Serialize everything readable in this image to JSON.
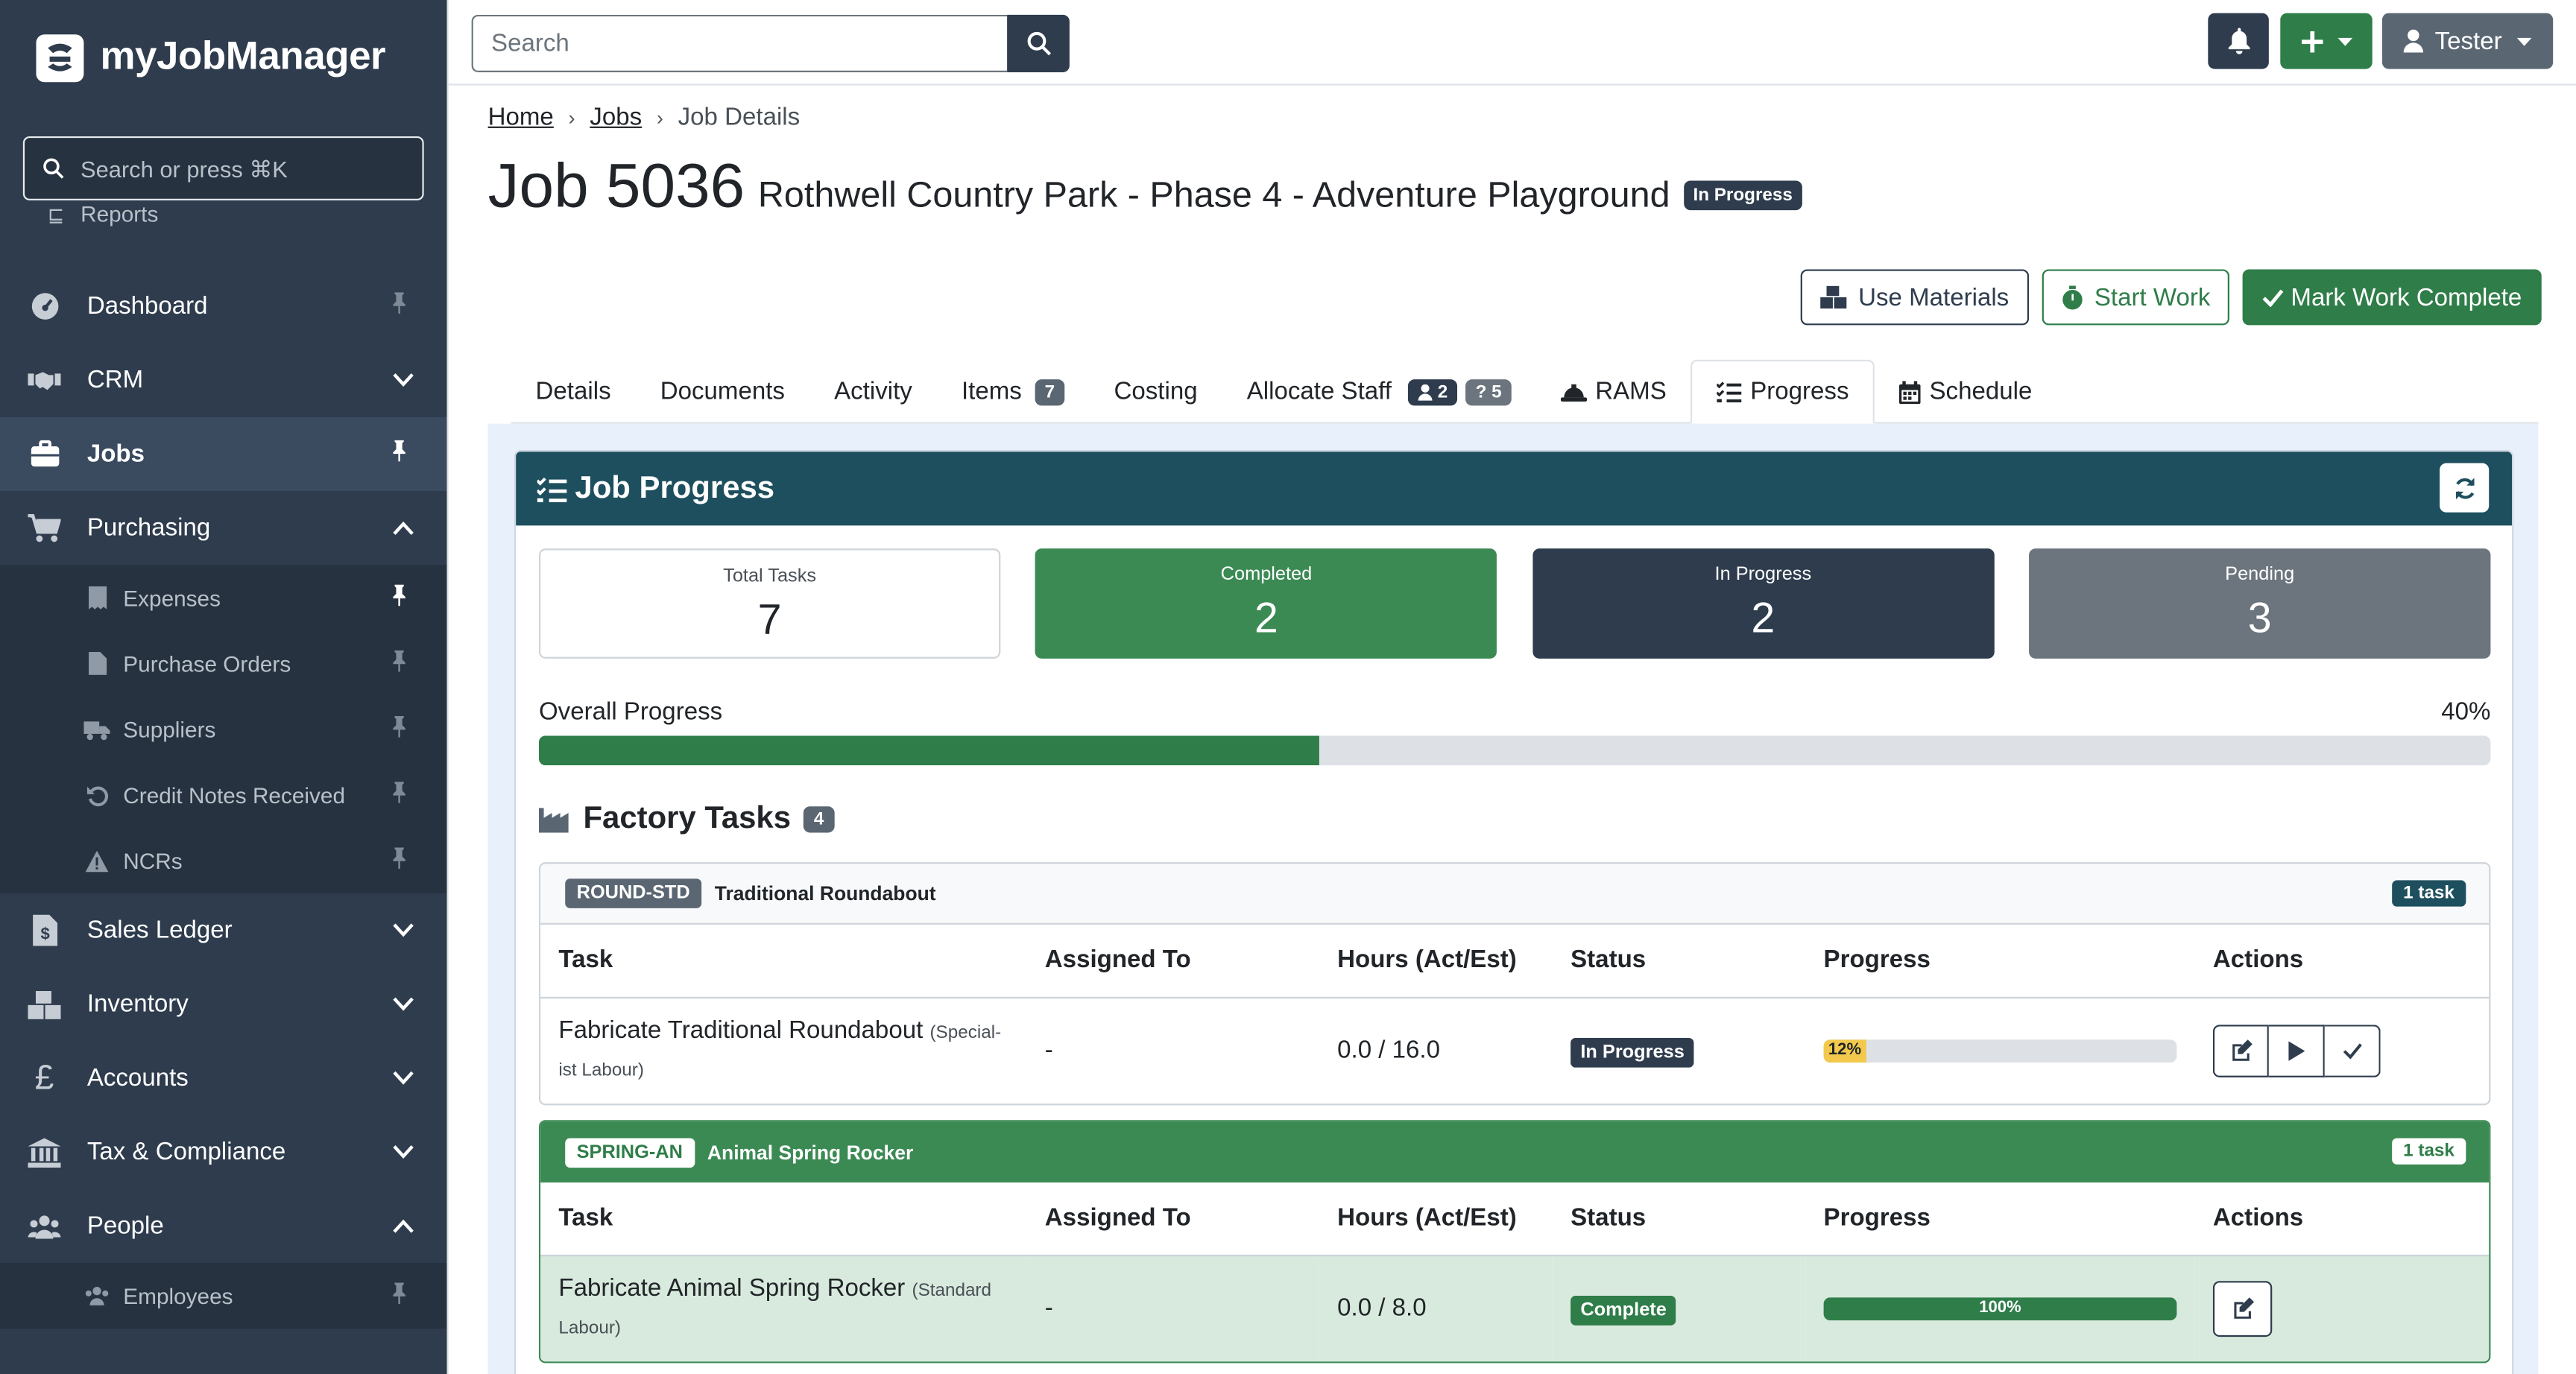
{
  "app": {
    "brand": "myJobManager"
  },
  "sidebar": {
    "search_placeholder": "Search or press ⌘K",
    "reports_label": "Reports",
    "items": [
      {
        "label": "Dashboard",
        "icon": "gauge-icon"
      },
      {
        "label": "CRM",
        "icon": "handshake-icon"
      },
      {
        "label": "Jobs",
        "icon": "briefcase-icon"
      },
      {
        "label": "Purchasing",
        "icon": "cart-icon"
      },
      {
        "label": "Sales Ledger",
        "icon": "invoice-dollar-icon"
      },
      {
        "label": "Inventory",
        "icon": "boxes-icon"
      },
      {
        "label": "Accounts",
        "icon": "pound-icon"
      },
      {
        "label": "Tax & Compliance",
        "icon": "bank-icon"
      },
      {
        "label": "People",
        "icon": "users-icon"
      }
    ],
    "purchasing_sub": [
      {
        "label": "Expenses"
      },
      {
        "label": "Purchase Orders"
      },
      {
        "label": "Suppliers"
      },
      {
        "label": "Credit Notes Received"
      },
      {
        "label": "NCRs"
      }
    ],
    "people_sub": [
      {
        "label": "Employees"
      }
    ]
  },
  "topbar": {
    "search_placeholder": "Search",
    "user_label": "Tester"
  },
  "breadcrumb": [
    "Home",
    "Jobs",
    "Job Details"
  ],
  "job": {
    "number": "Job 5036",
    "name": "Rothwell Country Park - Phase 4 - Adventure Playground",
    "status": "In Progress"
  },
  "actions": {
    "use_materials": "Use Materials",
    "start_work": "Start Work",
    "mark_complete": "Mark Work Complete"
  },
  "tabs": [
    {
      "label": "Details"
    },
    {
      "label": "Documents"
    },
    {
      "label": "Activity"
    },
    {
      "label": "Items",
      "count": "7"
    },
    {
      "label": "Costing"
    },
    {
      "label": "Allocate Staff",
      "staff_count": "2",
      "unknown_count": "5"
    },
    {
      "label": "RAMS"
    },
    {
      "label": "Progress"
    },
    {
      "label": "Schedule"
    }
  ],
  "progress": {
    "title": "Job Progress",
    "stats": [
      {
        "label": "Total Tasks",
        "value": "7"
      },
      {
        "label": "Completed",
        "value": "2"
      },
      {
        "label": "In Progress",
        "value": "2"
      },
      {
        "label": "Pending",
        "value": "3"
      }
    ],
    "overall_label": "Overall Progress",
    "overall_text": "40%",
    "overall_fraction": 0.4
  },
  "factory_tasks": {
    "title": "Factory Tasks",
    "count": "4",
    "columns": [
      "Task",
      "Assigned To",
      "Hours (Act/Est)",
      "Status",
      "Progress",
      "Actions"
    ],
    "groups": [
      {
        "code": "ROUND-STD",
        "name": "Traditional Roundabout",
        "count_label": "1 task",
        "task": {
          "name": "Fabricate Traditional Roundabout",
          "type": "(Special-ist Labour)",
          "assigned": "-",
          "hours": "0.0 / 16.0",
          "status": "In Progress",
          "progress_text": "12%",
          "progress_fraction": 0.12
        }
      },
      {
        "code": "SPRING-AN",
        "name": "Animal Spring Rocker",
        "count_label": "1 task",
        "task": {
          "name": "Fabricate Animal Spring Rocker",
          "type": "(Standard Labour)",
          "assigned": "-",
          "hours": "0.0 / 8.0",
          "status": "Complete",
          "progress_text": "100%",
          "progress_fraction": 1.0
        }
      }
    ]
  },
  "colors": {
    "primary_dark": "#2e3c4d",
    "success": "#2f7d49",
    "panel_header": "#1e4f5e",
    "warning": "#f2c94c"
  }
}
